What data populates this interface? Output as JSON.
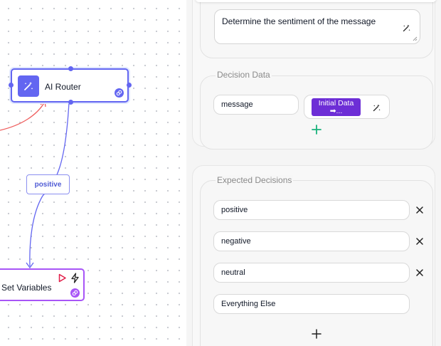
{
  "canvas": {
    "ai_router_node": {
      "title": "AI Router"
    },
    "edge_label": "positive",
    "set_variables_node": {
      "title": "Set Variables"
    }
  },
  "panel": {
    "instructions": {
      "value": "Determine the sentiment of the message"
    },
    "decision_data": {
      "label": "Decision Data",
      "key": "message",
      "value_chip": "Initial Data ➡..."
    },
    "expected_decisions": {
      "label": "Expected Decisions",
      "items": [
        "positive",
        "negative",
        "neutral"
      ],
      "fallback": "Everything Else"
    }
  },
  "colors": {
    "accent": "#6366f1",
    "purple": "#a855f7",
    "chip": "#6d2ed6",
    "edge_red": "#ef5e5e",
    "add_green": "#19b27b"
  }
}
